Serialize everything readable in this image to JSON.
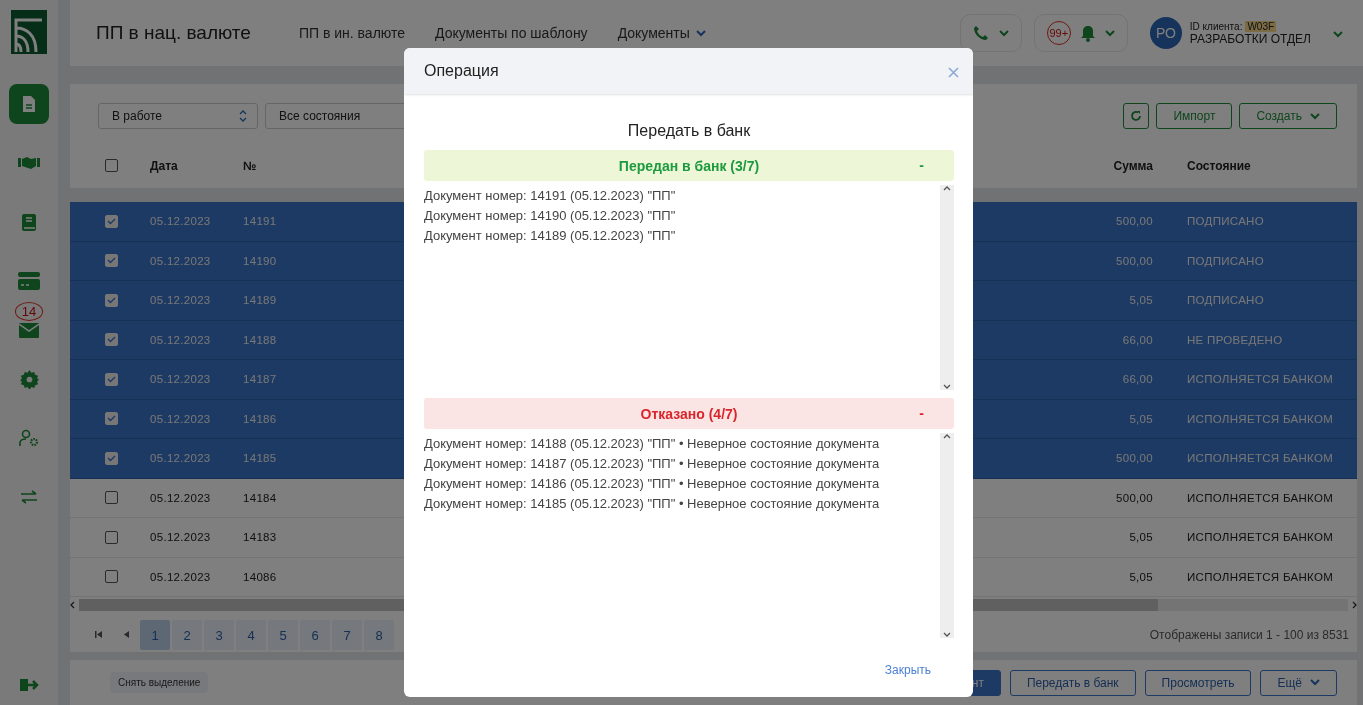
{
  "sidebar": {
    "items": [
      {
        "kind": "document",
        "selected": true
      },
      {
        "kind": "handshake",
        "selected": false
      },
      {
        "kind": "book",
        "selected": false
      },
      {
        "kind": "card",
        "selected": false
      },
      {
        "kind": "mail",
        "selected": false,
        "badge": "14"
      },
      {
        "kind": "gear",
        "selected": false
      },
      {
        "kind": "user-gear",
        "selected": false
      },
      {
        "kind": "transfer",
        "selected": false
      }
    ]
  },
  "header": {
    "title": "ПП в нац. валюте",
    "nav": [
      {
        "label": "ПП в ин. валюте",
        "dropdown": false
      },
      {
        "label": "Документы по шаблону",
        "dropdown": false
      },
      {
        "label": "Документы",
        "dropdown": true
      }
    ],
    "notifications": "99+",
    "client": {
      "avatar": "РО",
      "id_label": "ID клиента:",
      "id_value": "W03F",
      "name": "РАЗРАБОТКИ ОТДЕЛ"
    }
  },
  "filters": [
    "В работе",
    "Все состояния"
  ],
  "toolbar": [
    "Импорт",
    "Создать"
  ],
  "table": {
    "select_all_checked": false,
    "columns": [
      "Дата",
      "№",
      "Сумма",
      "Состояние"
    ],
    "rows": [
      {
        "selected": true,
        "checked": true,
        "date": "05.12.2023",
        "number": "14191",
        "amount": "500,00",
        "status": "ПОДПИСАНО"
      },
      {
        "selected": true,
        "checked": true,
        "date": "05.12.2023",
        "number": "14190",
        "amount": "500,00",
        "status": "ПОДПИСАНО"
      },
      {
        "selected": true,
        "checked": true,
        "date": "05.12.2023",
        "number": "14189",
        "amount": "5,05",
        "status": "ПОДПИСАНО"
      },
      {
        "selected": true,
        "checked": true,
        "date": "05.12.2023",
        "number": "14188",
        "amount": "66,00",
        "status": "НЕ ПРОВЕДЕНО"
      },
      {
        "selected": true,
        "checked": true,
        "date": "05.12.2023",
        "number": "14187",
        "amount": "66,00",
        "status": "ИСПОЛНЯЕТСЯ БАНКОМ"
      },
      {
        "selected": true,
        "checked": true,
        "date": "05.12.2023",
        "number": "14186",
        "amount": "5,05",
        "status": "ИСПОЛНЯЕТСЯ БАНКОМ"
      },
      {
        "selected": true,
        "checked": true,
        "date": "05.12.2023",
        "number": "14185",
        "amount": "500,00",
        "status": "ИСПОЛНЯЕТСЯ БАНКОМ"
      },
      {
        "selected": false,
        "checked": false,
        "date": "05.12.2023",
        "number": "14184",
        "amount": "500,00",
        "status": "ИСПОЛНЯЕТСЯ БАНКОМ"
      },
      {
        "selected": false,
        "checked": false,
        "date": "05.12.2023",
        "number": "14183",
        "amount": "5,05",
        "status": "ИСПОЛНЯЕТСЯ БАНКОМ"
      },
      {
        "selected": false,
        "checked": false,
        "date": "05.12.2023",
        "number": "14086",
        "amount": "5,05",
        "status": "ИСПОЛНЯЕТСЯ БАНКОМ"
      }
    ]
  },
  "pagination": {
    "pages": [
      {
        "label": "1",
        "selected": true
      },
      {
        "label": "2",
        "selected": false
      },
      {
        "label": "3",
        "selected": false
      },
      {
        "label": "4",
        "selected": false
      },
      {
        "label": "5",
        "selected": false
      },
      {
        "label": "6",
        "selected": false
      },
      {
        "label": "7",
        "selected": false
      },
      {
        "label": "8",
        "selected": false
      }
    ],
    "records": "Отображены записи 1 - 100 из 8531"
  },
  "footer": {
    "clear": "Снять выделение",
    "buttons": [
      {
        "label": "нт",
        "primary": true,
        "dropdown": false
      },
      {
        "label": "Передать в банк",
        "primary": false,
        "dropdown": false
      },
      {
        "label": "Просмотреть",
        "primary": false,
        "dropdown": false
      },
      {
        "label": "Ещё",
        "primary": false,
        "dropdown": true
      }
    ]
  },
  "modal": {
    "title": "Операция",
    "heading": "Передать в банк",
    "groups": [
      {
        "kind": "success",
        "title": "Передан в банк (3/7)",
        "toggle": "-",
        "items": [
          "Документ номер: 14191 (05.12.2023) \"ПП\"",
          "Документ номер: 14190 (05.12.2023) \"ПП\"",
          "Документ номер: 14189 (05.12.2023) \"ПП\""
        ]
      },
      {
        "kind": "error",
        "title": "Отказано (4/7)",
        "toggle": "-",
        "items": [
          "Документ номер: 14188 (05.12.2023) \"ПП\" • Неверное состояние документа",
          "Документ номер: 14187 (05.12.2023) \"ПП\" • Неверное состояние документа",
          "Документ номер: 14186 (05.12.2023) \"ПП\" • Неверное состояние документа",
          "Документ номер: 14185 (05.12.2023) \"ПП\" • Неверное состояние документа"
        ]
      }
    ],
    "close": "Закрыть"
  }
}
